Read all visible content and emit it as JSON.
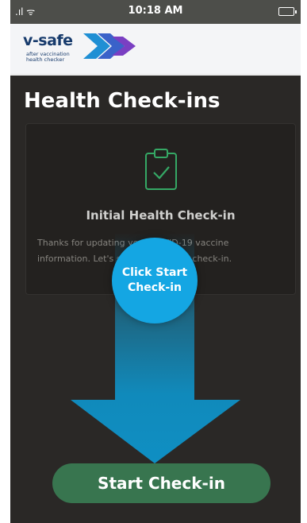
{
  "status_bar": {
    "time": "10:18 AM"
  },
  "logo": {
    "word": "v-safe",
    "subtitle_line1": "after vaccination",
    "subtitle_line2": "health checker"
  },
  "screen": {
    "title": "Health Check-ins",
    "card": {
      "icon": "clipboard-check-icon",
      "title": "Initial Health Check-in",
      "description_line1": "Thanks for updating your COVID-19 vaccine",
      "description_line2": "information. Let's start your health check-in."
    },
    "callout": {
      "line1": "Click Start",
      "line2": "Check-in"
    },
    "start_button_label": "Start Check-in"
  },
  "colors": {
    "status_bar": "#4d4e4a",
    "screen_bg": "#2a2826",
    "callout": "#14a6e3",
    "button": "#38754f",
    "icon_accent": "#35a865",
    "logo_text": "#173b6c"
  }
}
